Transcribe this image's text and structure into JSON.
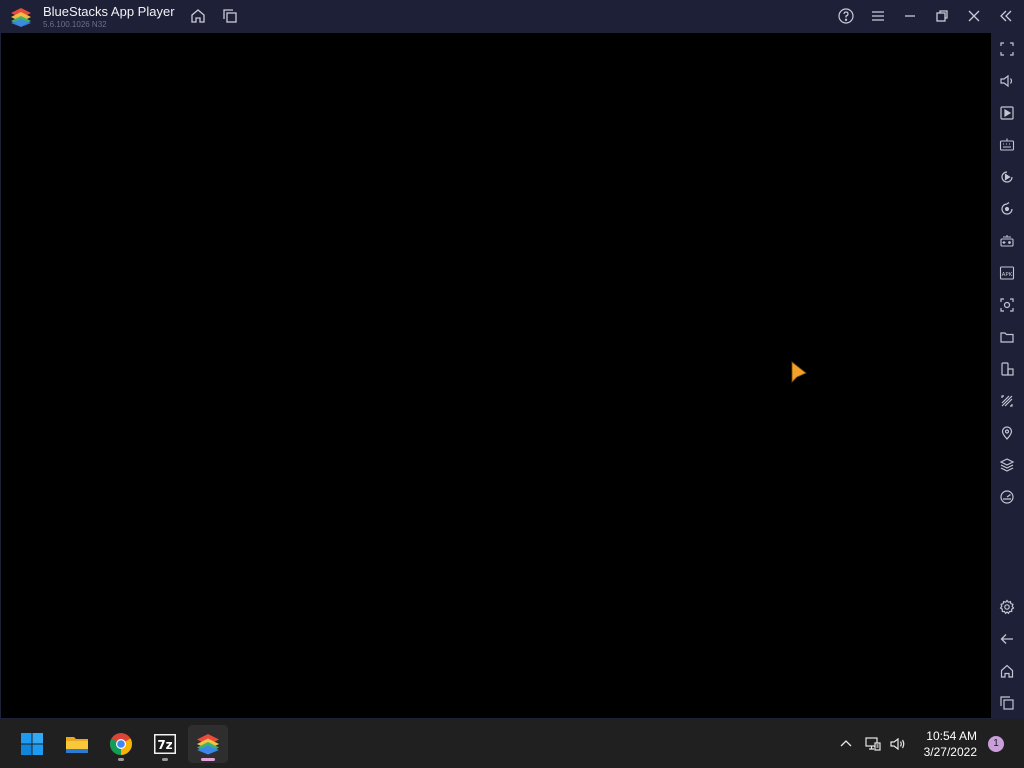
{
  "window": {
    "title": "BlueStacks App Player",
    "version": "5.6.100.1026  N32"
  },
  "titlebar_icons": [
    "home-icon",
    "multi-instance-icon",
    "help-icon",
    "menu-icon",
    "minimize-icon",
    "restore-icon",
    "close-icon",
    "collapse-sidebar-icon"
  ],
  "sidebar_icons": [
    "fullscreen-icon",
    "volume-icon",
    "media-manager-icon",
    "keyboard-controls-icon",
    "macro-recorder-icon",
    "sync-icon",
    "game-controls-icon",
    "apk-install-icon",
    "screenshot-icon",
    "folder-icon",
    "multi-instance-manager-icon",
    "eco-mode-icon",
    "location-icon",
    "layers-icon",
    "performance-icon",
    "settings-icon",
    "back-icon",
    "android-home-icon",
    "recent-apps-icon"
  ],
  "taskbar": {
    "apps": [
      "start-button",
      "file-explorer",
      "chrome",
      "7-zip",
      "bluestacks"
    ],
    "active_app": "bluestacks",
    "clock": {
      "time": "10:54 AM",
      "date": "3/27/2022"
    },
    "notification_count": "1"
  },
  "colors": {
    "titlebar_bg": "#1e2037",
    "taskbar_bg": "#202020",
    "accent": "#e6a2d6"
  }
}
